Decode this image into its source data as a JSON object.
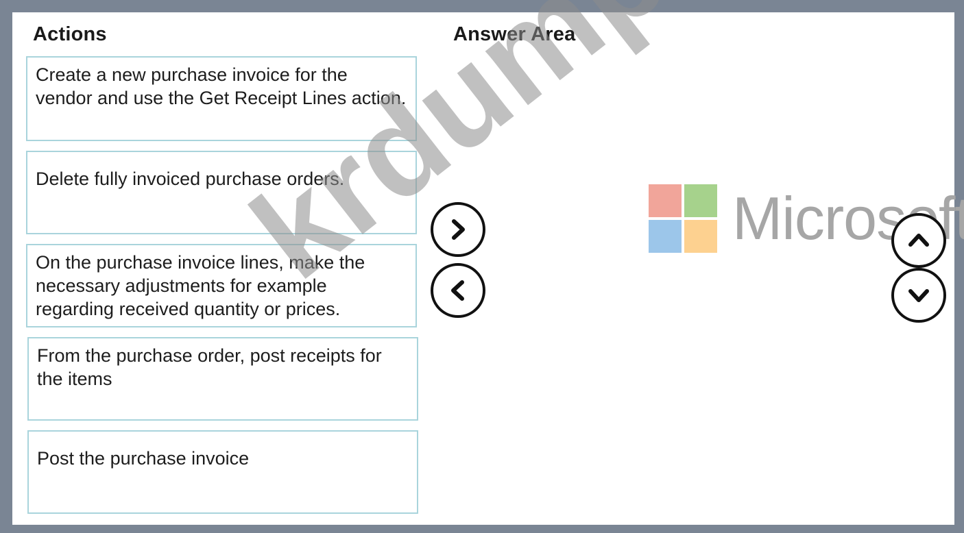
{
  "headings": {
    "actions": "Actions",
    "answer_area": "Answer Area"
  },
  "actions": [
    {
      "label": "Create a new purchase invoice for the vendor and use the Get Receipt Lines action."
    },
    {
      "label": "Delete fully invoiced purchase orders."
    },
    {
      "label": "On the purchase invoice lines, make the necessary adjustments for example regarding received quantity or prices."
    },
    {
      "label": "From the purchase order, post receipts for the items"
    },
    {
      "label": "Post the purchase  invoice"
    }
  ],
  "controls": {
    "move_right_icon": "chevron-right-icon",
    "move_left_icon": "chevron-left-icon",
    "move_up_icon": "chevron-up-icon",
    "move_down_icon": "chevron-down-icon"
  },
  "logo": {
    "text": "Microsoft",
    "colors": [
      "#f1a59a",
      "#a6d28c",
      "#9cc6ea",
      "#fdd190"
    ]
  },
  "watermark": {
    "text": "krdump.com"
  },
  "colors": {
    "border": "#7a8594",
    "item_border": "#a9d4dc"
  }
}
